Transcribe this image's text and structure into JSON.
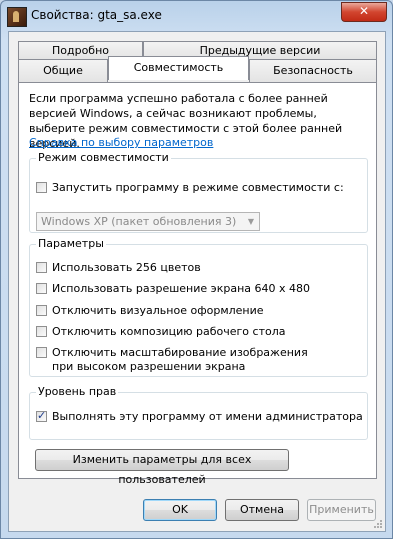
{
  "window": {
    "title": "Свойства: gta_sa.exe",
    "close_label": "✕"
  },
  "tabs": {
    "row_top": [
      "Подробно",
      "Предыдущие версии"
    ],
    "row_bottom": [
      "Общие",
      "Совместимость",
      "Безопасность"
    ],
    "active": "Совместимость"
  },
  "compat": {
    "intro": "Если программа успешно работала с более ранней версией Windows, а сейчас возникают проблемы, выберите режим совместимости с этой более ранней версией.",
    "help_link": "Справка по выбору параметров",
    "mode_group": {
      "title": "Режим совместимости",
      "checkbox_label": "Запустить программу в режиме совместимости с:",
      "checked": false,
      "select_value": "Windows XP (пакет обновления 3)"
    },
    "params_group": {
      "title": "Параметры",
      "options": [
        {
          "label": "Использовать 256 цветов",
          "checked": false
        },
        {
          "label": "Использовать разрешение экрана 640 x 480",
          "checked": false
        },
        {
          "label": "Отключить визуальное оформление",
          "checked": false
        },
        {
          "label": "Отключить композицию рабочего стола",
          "checked": false
        },
        {
          "label": "Отключить масштабирование изображения при высоком разрешении экрана",
          "checked": false
        }
      ]
    },
    "rights_group": {
      "title": "Уровень прав",
      "checkbox_label": "Выполнять эту программу от имени администратора",
      "checked": true
    },
    "all_users_button": "Изменить параметры для всех пользователей"
  },
  "buttons": {
    "ok": "OK",
    "cancel": "Отмена",
    "apply": "Применить"
  }
}
